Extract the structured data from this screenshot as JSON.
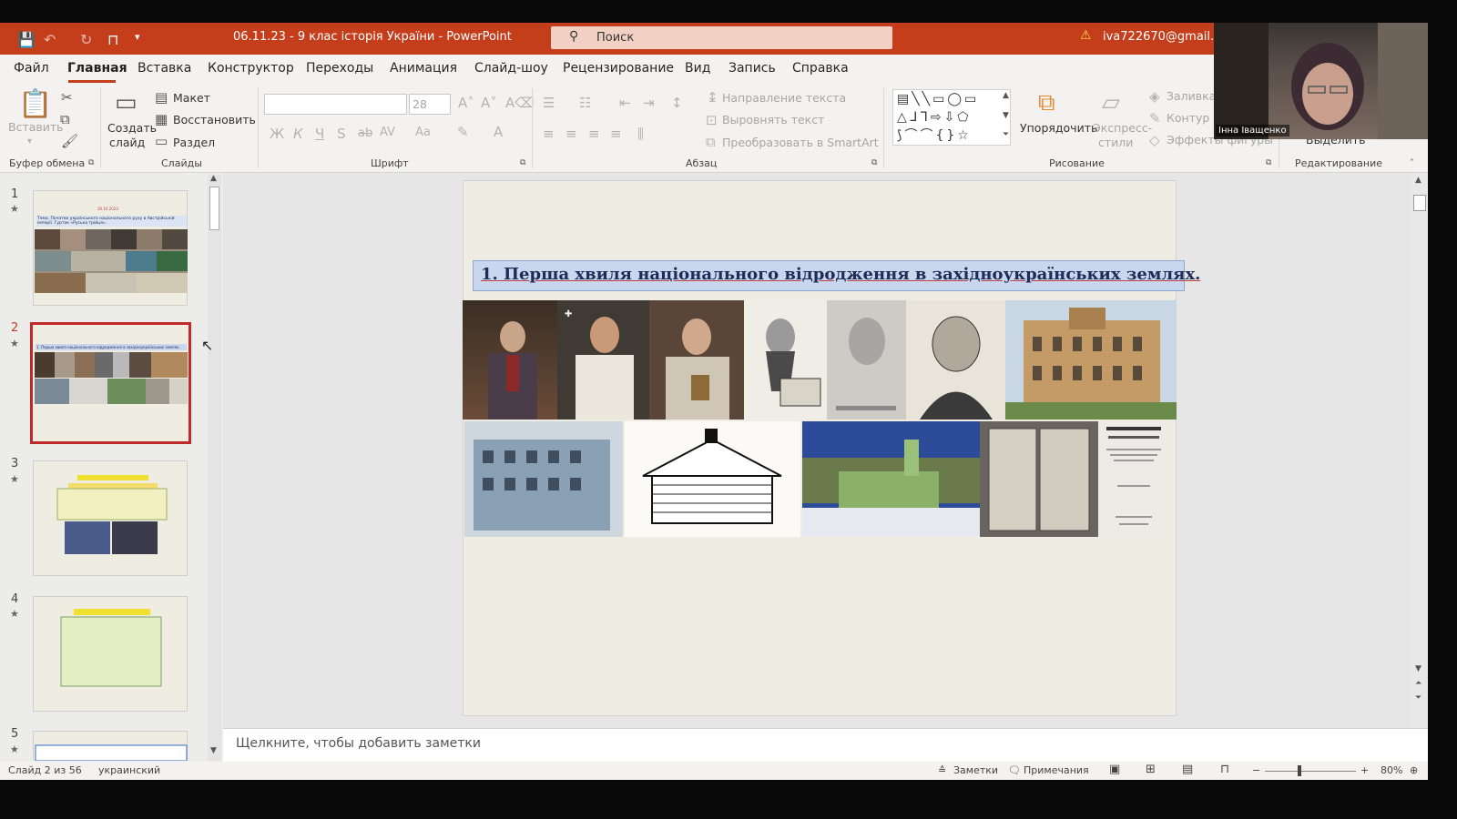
{
  "titlebar": {
    "doc_title": "06.11.23 - 9 клас історія України  -  PowerPoint",
    "search_placeholder": "Поиск",
    "account": "iva722670@gmail.com"
  },
  "menu": [
    "Файл",
    "Главная",
    "Вставка",
    "Конструктор",
    "Переходы",
    "Анимация",
    "Слайд-шоу",
    "Рецензирование",
    "Вид",
    "Запись",
    "Справка"
  ],
  "ribbon": {
    "paste": "Вставить",
    "create_slide_1": "Создать",
    "create_slide_2": "слайд",
    "layout": "Макет",
    "reset": "Восстановить",
    "section": "Раздел",
    "font_size": "28",
    "text_direction": "Направление текста",
    "align_text": "Выровнять текст",
    "smartart": "Преобразовать в SmartArt",
    "arrange": "Упорядочить",
    "quick_styles_1": "Экспресс-",
    "quick_styles_2": "стили",
    "fill": "Заливка",
    "outline": "Контур ф",
    "effects": "Эффекты фигуры",
    "select": "Выделить",
    "font_btns": [
      "Ж",
      "К",
      "Ч",
      "S",
      "ab",
      "AV",
      "Aa"
    ],
    "groups": {
      "clipboard": "Буфер обмена",
      "slides": "Слайды",
      "font": "Шрифт",
      "paragraph": "Абзац",
      "drawing": "Рисование",
      "editing": "Редактирование"
    }
  },
  "thumbnails": [
    {
      "num": "1",
      "date": "30.10.2023",
      "text": "Тема. Початки українського національного руху в Австрійській імперії. Гурток «Руська трійця»."
    },
    {
      "num": "2",
      "text": "1. Перша хвиля національного відродження в західноукраїнських землях."
    },
    {
      "num": "3"
    },
    {
      "num": "4"
    },
    {
      "num": "5"
    }
  ],
  "slide": {
    "title": "1. Перша хвиля національного відродження в західноукраїнських землях."
  },
  "webcam_name": "Інна Іващенко",
  "notes_placeholder": "Щелкните, чтобы добавить заметки",
  "status": {
    "slide_info": "Слайд 2 из 56",
    "language": "украинский",
    "notes_btn": "Заметки",
    "comments_btn": "Примечания",
    "zoom": "80%"
  },
  "colors": {
    "accent": "#c43e1c",
    "selection": "#c0292a",
    "title_bg": "#c9d7ee"
  }
}
